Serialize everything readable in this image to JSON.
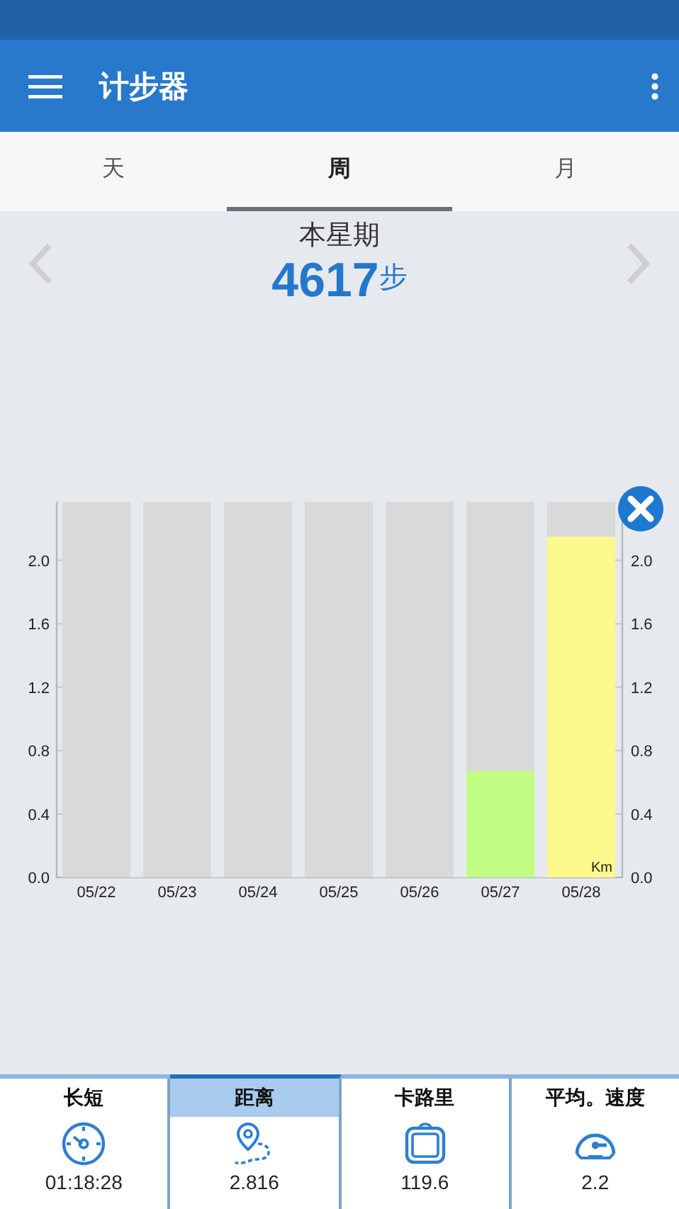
{
  "app_bar": {
    "title": "计步器"
  },
  "tabs": [
    {
      "label": "天",
      "selected": false
    },
    {
      "label": "周",
      "selected": true
    },
    {
      "label": "月",
      "selected": false
    }
  ],
  "summary": {
    "period": "本星期",
    "steps": "4617",
    "unit": "步"
  },
  "chart_data": {
    "type": "bar",
    "categories": [
      "05/22",
      "05/23",
      "05/24",
      "05/25",
      "05/26",
      "05/27",
      "05/28"
    ],
    "series": [
      {
        "name": "Km",
        "values": [
          0,
          0,
          0,
          0,
          0,
          0.67,
          2.15
        ],
        "colors": [
          null,
          null,
          null,
          null,
          null,
          "#c2fd83",
          "#fdf98d"
        ]
      }
    ],
    "ylim": [
      0,
      2.37
    ],
    "grid": true,
    "yticks": [
      {
        "value": 0,
        "label": "0.0"
      },
      {
        "value": 0.4,
        "label": "0.4"
      },
      {
        "value": 0.8,
        "label": "0.8"
      },
      {
        "value": 1.2,
        "label": "1.2"
      },
      {
        "value": 1.6,
        "label": "1.6"
      },
      {
        "value": 2.0,
        "label": "2.0"
      }
    ],
    "annotations": [
      "0.0",
      "0.4",
      "0.8",
      "1.2",
      "1.6",
      "2.0"
    ]
  },
  "stats": [
    {
      "label": "长短",
      "value": "01:18:28",
      "kind": "duration",
      "selected": false
    },
    {
      "label": "距离",
      "value": "2.816",
      "kind": "distance",
      "selected": true
    },
    {
      "label": "卡路里",
      "value": "119.6",
      "kind": "calories",
      "selected": false
    },
    {
      "label": "平均。速度",
      "value": "2.2",
      "kind": "speed",
      "selected": false
    }
  ]
}
